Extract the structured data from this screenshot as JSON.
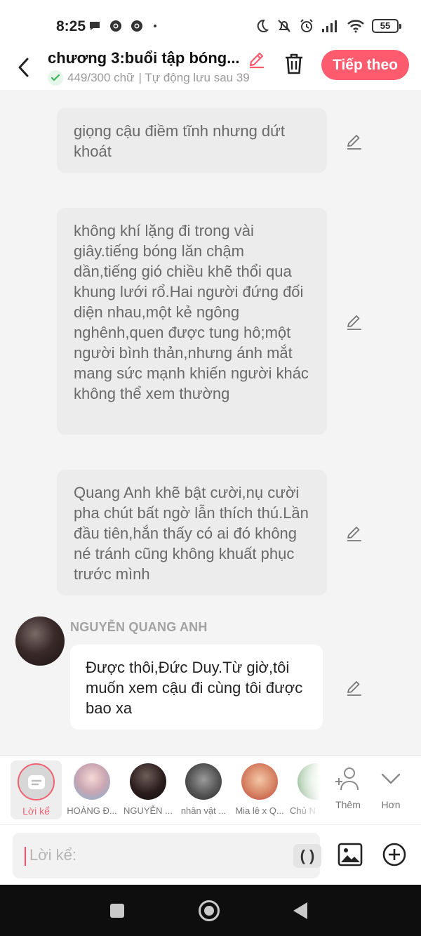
{
  "status_bar": {
    "time": "8:25",
    "battery": "55"
  },
  "header": {
    "title": "chương 3:buổi tập bóng...",
    "word_count": "449/300 chữ",
    "autosave": "| Tự động lưu sau 39",
    "next_label": "Tiếp theo"
  },
  "messages": [
    {
      "type": "narration",
      "text": "giọng cậu điềm tĩnh nhưng dứt khoát"
    },
    {
      "type": "narration",
      "text": "không khí lặng đi trong vài giây.tiếng bóng lăn chậm dần,tiếng gió chiều khẽ thổi qua khung lưới rổ.Hai người đứng đối diện nhau,một kẻ ngông nghênh,quen được tung hô;một người bình thản,nhưng ánh mắt mang sức mạnh khiến người khác không thể xem thường"
    },
    {
      "type": "narration",
      "text": "Quang Anh khẽ bật cười,nụ cười pha chút bất ngờ lẫn thích thú.Lần đầu tiên,hắn thấy có ai đó không né tránh cũng không khuất phục trước mình"
    },
    {
      "type": "character",
      "name": "NGUYỄN QUANG ANH",
      "text": "Được thôi,Đức Duy.Từ giờ,tôi muốn xem cậu đi cùng tôi được bao xa"
    }
  ],
  "picker": {
    "narration_label": "Lời kể",
    "characters": [
      {
        "label": "HOÀNG Đ..."
      },
      {
        "label": "NGUYỄN ..."
      },
      {
        "label": "nhân vật ..."
      },
      {
        "label": "Mia lê x Q..."
      },
      {
        "label": "Chủ N"
      }
    ],
    "add_label": "Thêm",
    "more_label": "Hơn"
  },
  "input": {
    "placeholder": "Lời kể:",
    "paren": "( )"
  },
  "colors": {
    "accent": "#ff5b6e",
    "narration_bubble": "#ececec",
    "dialogue_bubble": "#ffffff"
  }
}
